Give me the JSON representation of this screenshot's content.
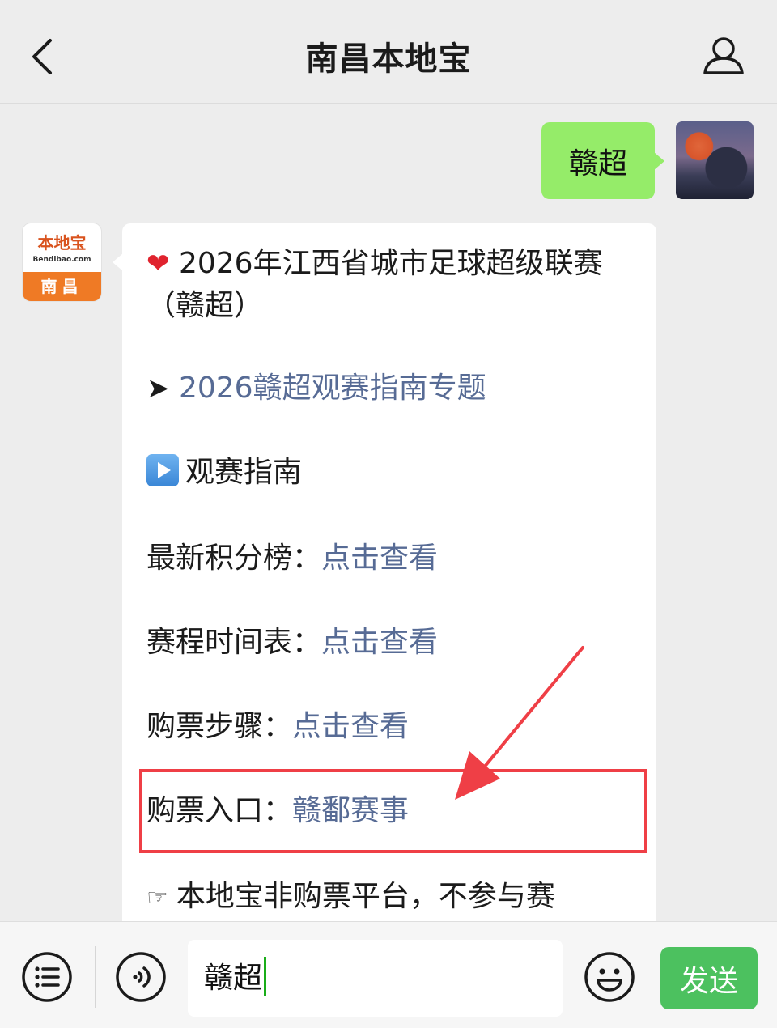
{
  "header": {
    "title": "南昌本地宝"
  },
  "chat": {
    "user_message": "赣超",
    "bot_avatar": {
      "logo_text": "本地宝",
      "logo_sub": "Bendibao.com",
      "city": "南昌"
    },
    "bot_message": {
      "heading": "2026年江西省城市足球超级联赛（赣超）",
      "topic_link": "2026赣超观赛指南专题",
      "section_title": "观赛指南",
      "rows": [
        {
          "label": "最新积分榜：",
          "link": "点击查看"
        },
        {
          "label": "赛程时间表：",
          "link": "点击查看"
        },
        {
          "label": "购票步骤：",
          "link": "点击查看"
        },
        {
          "label": "购票入口：",
          "link": "赣鄱赛事"
        }
      ],
      "notice": "本地宝非购票平台，不参与赛"
    }
  },
  "input_bar": {
    "input_value": "赣超",
    "send_label": "发送"
  },
  "colors": {
    "link": "#576b95",
    "user_bubble": "#95ec69",
    "send_button": "#4cc15f",
    "highlight": "#ef3f46"
  },
  "icons": [
    "back-chevron-icon",
    "profile-icon",
    "menu-list-icon",
    "voice-icon",
    "emoji-icon",
    "heart-icon",
    "arrow-icon",
    "play-icon",
    "pointing-hand-icon"
  ]
}
